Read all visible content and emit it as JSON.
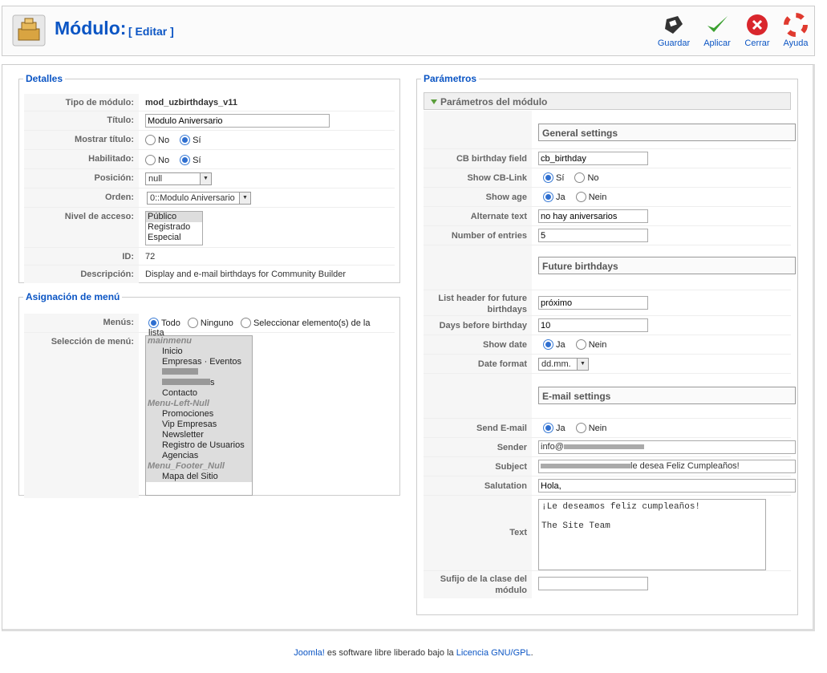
{
  "header": {
    "title": "Módulo:",
    "subtitle": "[ Editar ]"
  },
  "toolbar": {
    "save": "Guardar",
    "apply": "Aplicar",
    "close": "Cerrar",
    "help": "Ayuda"
  },
  "details": {
    "legend": "Detalles",
    "module_type_label": "Tipo de módulo:",
    "module_type_value": "mod_uzbirthdays_v11",
    "title_label": "Título:",
    "title_value": "Modulo Aniversario",
    "show_title_label": "Mostrar título:",
    "enabled_label": "Habilitado:",
    "no": "No",
    "yes": "Sí",
    "position_label": "Posición:",
    "position_value": "null",
    "order_label": "Orden:",
    "order_value": "0::Modulo Aniversario",
    "access_label": "Nivel de acceso:",
    "access_options": [
      "Público",
      "Registrado",
      "Especial"
    ],
    "id_label": "ID:",
    "id_value": "72",
    "desc_label": "Descripción:",
    "desc_value": "Display and e-mail birthdays for Community Builder"
  },
  "menu_assign": {
    "legend": "Asignación de menú",
    "menus_label": "Menús:",
    "opt_all": "Todo",
    "opt_none": "Ninguno",
    "opt_select": "Seleccionar elemento(s) de la lista",
    "selection_label": "Selección de menú:",
    "items": {
      "g1": "mainmenu",
      "i1": "Inicio",
      "i2": "Empresas · Eventos",
      "i3": "s",
      "i4": "Contacto",
      "g2": "Menu-Left-Null",
      "i5": "Promociones",
      "i6": "Vip Empresas",
      "i7": "Newsletter",
      "i8": "Registro de Usuarios",
      "i9": "Agencias",
      "g3": "Menu_Footer_Null",
      "i10": "Mapa del Sitio"
    }
  },
  "params": {
    "legend": "Parámetros",
    "panel_title": "Parámetros del módulo",
    "general": "General settings",
    "cb_field_label": "CB birthday field",
    "cb_field_value": "cb_birthday",
    "show_link_label": "Show CB-Link",
    "si": "Sí",
    "no": "No",
    "show_age_label": "Show age",
    "ja": "Ja",
    "nein": "Nein",
    "alt_text_label": "Alternate text",
    "alt_text_value": "no hay aniversarios",
    "num_entries_label": "Number of entries",
    "num_entries_value": "5",
    "future": "Future birthdays",
    "list_header_label": "List header for future birthdays",
    "list_header_value": "próximo",
    "days_before_label": "Days before birthday",
    "days_before_value": "10",
    "show_date_label": "Show date",
    "date_format_label": "Date format",
    "date_format_value": "dd.mm.",
    "email": "E-mail settings",
    "send_email_label": "Send E-mail",
    "sender_label": "Sender",
    "sender_value": "info@",
    "subject_label": "Subject",
    "subject_value": "le desea Feliz Cumpleaños!",
    "salutation_label": "Salutation",
    "salutation_value": "Hola,",
    "text_label": "Text",
    "text_value": "¡Le deseamos feliz cumpleaños!\n\nThe Site Team",
    "suffix_label": "Sufijo de la clase del módulo",
    "suffix_value": ""
  },
  "footer": {
    "joomla": "Joomla!",
    "mid": " es software libre liberado bajo la ",
    "license": "Licencia GNU/GPL",
    "end": "."
  }
}
